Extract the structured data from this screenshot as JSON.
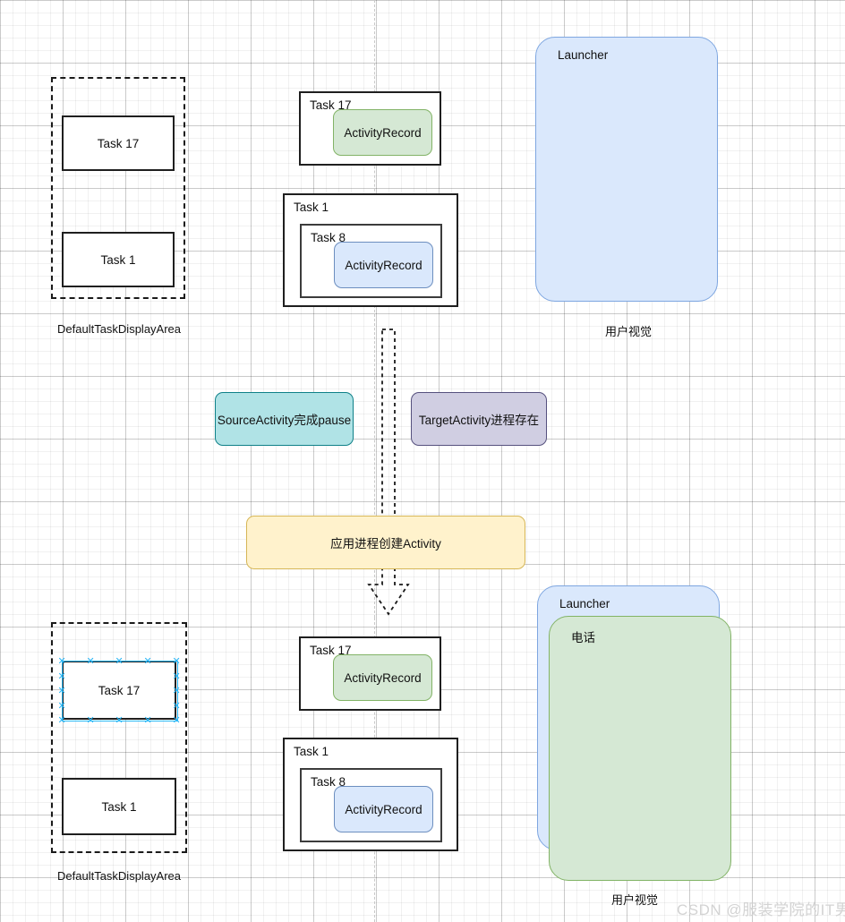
{
  "diagram": {
    "watermark": "CSDN @服装学院的IT男",
    "colors": {
      "green_fill": "#d5e8d4",
      "green_stroke": "#82b366",
      "blue_fill": "#dae8fc",
      "blue_stroke": "#7ea6e0",
      "teal_fill": "#b0e3e6",
      "teal_stroke": "#0e8088",
      "purple_fill": "#d0cee2",
      "purple_stroke": "#56517e",
      "yellow_fill": "#fff2cc",
      "yellow_stroke": "#d6b656",
      "selection_handle": "#29b6f6"
    },
    "top": {
      "display_area": {
        "caption": "DefaultTaskDisplayArea",
        "tasks": [
          {
            "label": "Task 17"
          },
          {
            "label": "Task 1"
          }
        ]
      },
      "stack": {
        "task17": {
          "title": "Task 17",
          "activity_record": "ActivityRecord"
        },
        "task1": {
          "title": "Task 1",
          "task8": {
            "title": "Task 8",
            "activity_record": "ActivityRecord"
          }
        }
      },
      "screen": {
        "window_title": "Launcher",
        "caption": "用户视觉"
      }
    },
    "notes": {
      "source_pause": "SourceActivity完成pause",
      "target_process": "TargetActivity进程存在",
      "create_activity": "应用进程创建Activity"
    },
    "bottom": {
      "display_area": {
        "caption": "DefaultTaskDisplayArea",
        "tasks": [
          {
            "label": "Task 17",
            "selected": true
          },
          {
            "label": "Task 1",
            "selected": false
          }
        ]
      },
      "stack": {
        "task17": {
          "title": "Task 17",
          "activity_record": "ActivityRecord"
        },
        "task1": {
          "title": "Task 1",
          "task8": {
            "title": "Task 8",
            "activity_record": "ActivityRecord"
          }
        }
      },
      "screen": {
        "back_window_title": "Launcher",
        "front_window_title": "电话",
        "caption": "用户视觉"
      }
    }
  }
}
